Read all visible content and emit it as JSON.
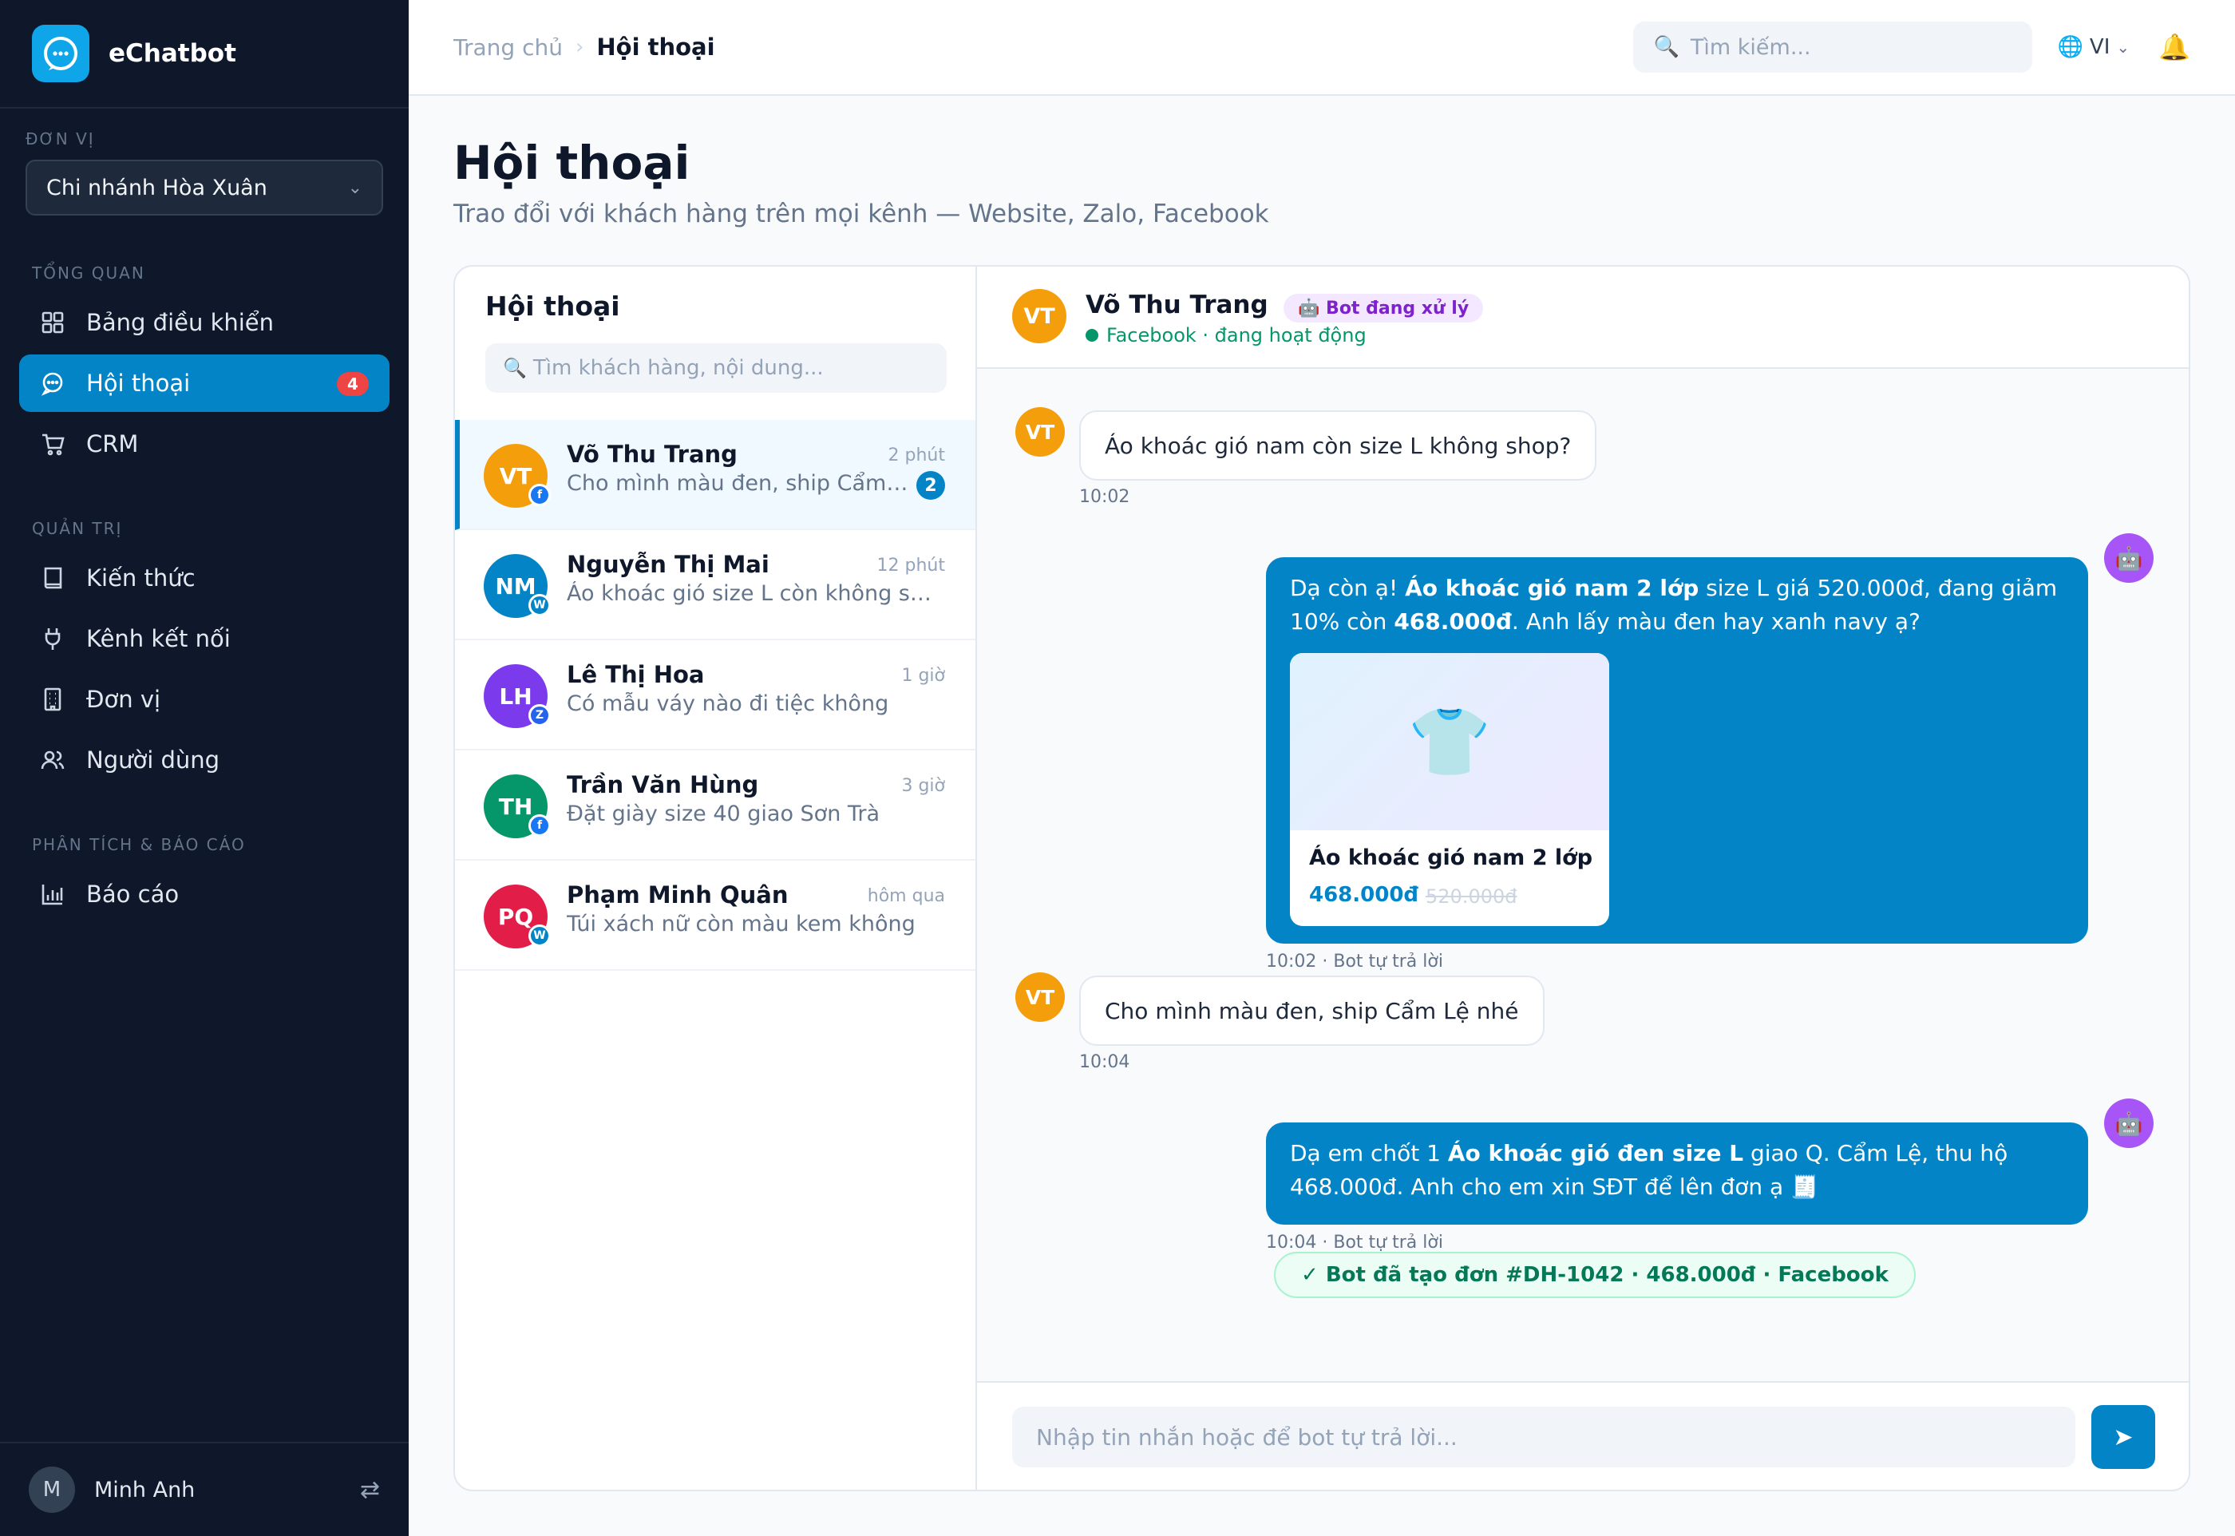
{
  "app": {
    "name": "eChatbot"
  },
  "sidebar": {
    "unit_label": "ĐƠN VỊ",
    "unit_value": "Chi nhánh Hòa Xuân",
    "sections": [
      {
        "label": "TỔNG QUAN"
      },
      {
        "label": "QUẢN TRỊ"
      },
      {
        "label": "PHÂN TÍCH & BÁO CÁO"
      }
    ],
    "items": [
      {
        "label": "Bảng điều khiển",
        "icon": "grid-icon"
      },
      {
        "label": "Hội thoại",
        "icon": "chat-icon",
        "badge": "4",
        "active": true
      },
      {
        "label": "CRM",
        "icon": "cart-icon"
      },
      {
        "label": "Kiến thức",
        "icon": "book-icon"
      },
      {
        "label": "Kênh kết nối",
        "icon": "plug-icon"
      },
      {
        "label": "Đơn vị",
        "icon": "building-icon"
      },
      {
        "label": "Người dùng",
        "icon": "users-icon"
      },
      {
        "label": "Báo cáo",
        "icon": "bar-chart-icon"
      }
    ],
    "user": {
      "initial": "M",
      "name": "Minh Anh",
      "switch_icon": "⇄"
    }
  },
  "topbar": {
    "breadcrumb": {
      "home": "Trang chủ",
      "separator": "›",
      "current": "Hội thoại"
    },
    "search_placeholder": "Tìm kiếm...",
    "search_icon": "🔍",
    "lang_icon": "🌐",
    "lang": "VI",
    "lang_chevron": "⌄",
    "bell": "🔔"
  },
  "page": {
    "title": "Hội thoại",
    "subtitle": "Trao đổi với khách hàng trên mọi kênh — Website, Zalo, Facebook"
  },
  "conversations": {
    "title": "Hội thoại",
    "search_icon": "🔍",
    "search_placeholder": "Tìm khách hàng, nội dung...",
    "items": [
      {
        "initials": "VT",
        "name": "Võ Thu Trang",
        "time": "2 phút",
        "preview": "Cho mình màu đen, ship Cẩm Lệ nhé",
        "unread": "2",
        "channel": "f",
        "channel_color": "#1877f2",
        "avatar_color": "#f59e0b",
        "active": true
      },
      {
        "initials": "NM",
        "name": "Nguyễn Thị Mai",
        "time": "12 phút",
        "preview": "Áo khoác gió size L còn không shop?",
        "channel": "W",
        "channel_color": "#0284c7",
        "avatar_color": "#0284c7"
      },
      {
        "initials": "LH",
        "name": "Lê Thị Hoa",
        "time": "1 giờ",
        "preview": "Có mẫu váy nào đi tiệc không",
        "channel": "Z",
        "channel_color": "#2563eb",
        "avatar_color": "#7c3aed"
      },
      {
        "initials": "TH",
        "name": "Trần Văn Hùng",
        "time": "3 giờ",
        "preview": "Đặt giày size 40 giao Sơn Trà",
        "channel": "f",
        "channel_color": "#1877f2",
        "avatar_color": "#059669"
      },
      {
        "initials": "PQ",
        "name": "Phạm Minh Quân",
        "time": "hôm qua",
        "preview": "Túi xách nữ còn màu kem không",
        "channel": "W",
        "channel_color": "#0284c7",
        "avatar_color": "#e11d48"
      }
    ]
  },
  "chat": {
    "avatar": "VT",
    "name": "Võ Thu Trang",
    "bot_status": "🤖 Bot đang xử lý",
    "status": "Facebook · đang hoạt động",
    "bot_avatar": "🤖",
    "messages": [
      {
        "text": "Áo khoác gió nam còn size L không shop?",
        "time": "10:02"
      },
      {
        "parts": {
          "a": "Dạ còn ạ! ",
          "b": "Áo khoác gió nam 2 lớp",
          "c": " size L giá 520.000đ, đang giảm 10% còn ",
          "d": "468.000đ",
          "e": ". Anh lấy màu đen hay xanh navy ạ?"
        },
        "time": "10:02 · Bot tự trả lời",
        "product": {
          "image": "👕",
          "name": "Áo khoác gió nam 2 lớp",
          "price": "468.000đ",
          "old_price": "520.000đ"
        }
      },
      {
        "text": "Cho mình màu đen, ship Cẩm Lệ nhé",
        "time": "10:04"
      },
      {
        "parts": {
          "a": "Dạ em chốt 1 ",
          "b": "Áo khoác gió đen size L",
          "c": " giao Q. Cẩm Lệ, thu hộ 468.000đ. Anh cho em xin SĐT để lên đơn ạ 🧾"
        },
        "time": "10:04 · Bot tự trả lời"
      }
    ],
    "order_notice": "✓ Bot đã tạo đơn #DH-1042 · 468.000đ · Facebook",
    "composer_placeholder": "Nhập tin nhắn hoặc để bot tự trả lời...",
    "send_icon": "➤"
  },
  "colors": {
    "sidebar_bg": "#0f172a",
    "accent": "#0284c7",
    "badge": "#ef4444",
    "bot_purple": "#a855f7",
    "success": "#059669"
  }
}
